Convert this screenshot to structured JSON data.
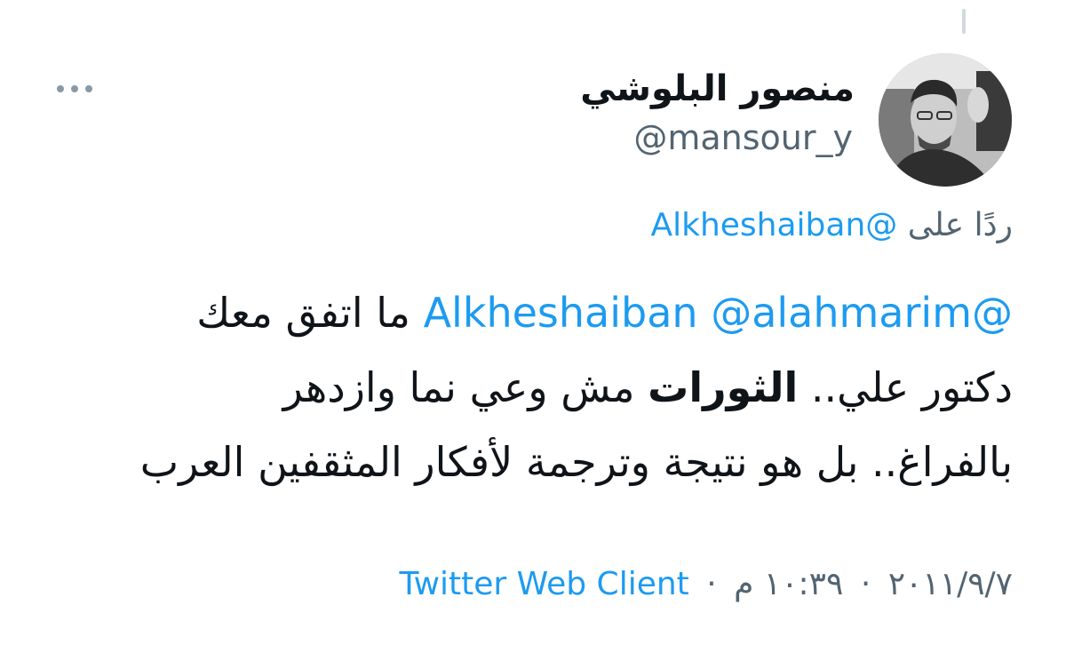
{
  "tweet": {
    "author": {
      "display_name": "منصور البلوشي",
      "handle": "@mansour_y"
    },
    "reply": {
      "prefix": "ردًا على",
      "mention": "@Alkheshaiban"
    },
    "text": {
      "line1_mention_1": "@Alkheshaiban",
      "line1_mention_2": "@alahmarim",
      "line1_text": "ما اتفق معك",
      "line2_before": "دكتور علي..",
      "line2_bold": "الثورات",
      "line2_after": "مش وعي نما وازدهر",
      "line3": "بالفراغ.. بل هو نتيجة وترجمة لأفكار المثقفين العرب"
    },
    "meta": {
      "date": "٢٠١١/٩/٧",
      "separator": "·",
      "time": "١٠:٣٩ م",
      "client": "Twitter Web Client"
    }
  },
  "icons": {
    "more": "more-horizontal-icon",
    "avatar": "avatar"
  },
  "colors": {
    "link": "#1d9bf0",
    "secondary": "#536471",
    "text": "#0f1419",
    "thread_line": "#cfd9de"
  }
}
